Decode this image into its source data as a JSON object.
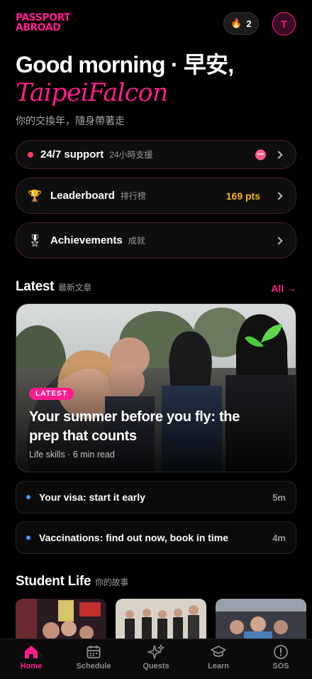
{
  "header": {
    "logo_line1": "PASSPORT",
    "logo_line2": "ABROAD",
    "streak_count": "2",
    "avatar_initial": "T"
  },
  "greeting": {
    "title": "Good morning · 早安,",
    "name": "TaipeiFalcon",
    "tagline": "你的交換年，隨身帶著走"
  },
  "quick_links": [
    {
      "label": "24/7 support",
      "sub": "24小時支援",
      "icon": "status-dot"
    },
    {
      "label": "Leaderboard",
      "sub": "排行榜",
      "value": "169 pts",
      "icon": "trophy-icon"
    },
    {
      "label": "Achievements",
      "sub": "成就",
      "icon": "medal-icon"
    }
  ],
  "latest": {
    "title": "Latest",
    "sub": "最新文章",
    "all_label": "All →",
    "featured": {
      "badge": "LATEST",
      "title": "Your summer before you fly: the prep that counts",
      "meta": "Life skills · 6 min read"
    },
    "items": [
      {
        "title": "Your visa: start it early",
        "time": "5m"
      },
      {
        "title": "Vaccinations: find out now, book in time",
        "time": "4m"
      }
    ]
  },
  "student_life": {
    "title": "Student Life",
    "sub": "你的故事"
  },
  "tabs": [
    {
      "label": "Home",
      "icon": "home-icon",
      "active": true
    },
    {
      "label": "Schedule",
      "icon": "calendar-icon"
    },
    {
      "label": "Quests",
      "icon": "sparkles-icon"
    },
    {
      "label": "Learn",
      "icon": "graduation-cap-icon"
    },
    {
      "label": "SOS",
      "icon": "alert-circle-icon"
    }
  ],
  "colors": {
    "accent": "#ff1d8e",
    "points": "#f0b429",
    "background": "#000000"
  }
}
